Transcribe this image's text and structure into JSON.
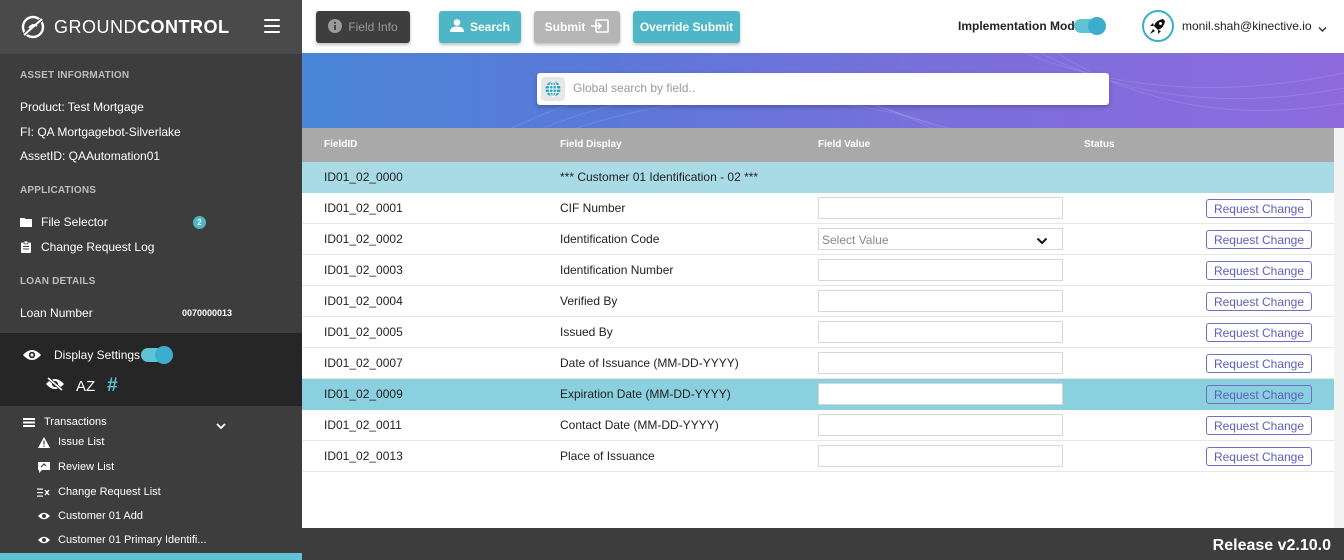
{
  "brand": {
    "name_light": "GROUND",
    "name_bold": "CONTROL"
  },
  "asset_info": {
    "title": "ASSET INFORMATION",
    "product": "Product:  Test Mortgage",
    "fi": "FI:  QA Mortgagebot-Silverlake",
    "asset_id": "AssetID:  QAAutomation01"
  },
  "applications": {
    "title": "APPLICATIONS",
    "items": [
      {
        "label": "File Selector",
        "badge": "2"
      },
      {
        "label": "Change Request Log"
      }
    ]
  },
  "loan_details": {
    "title": "LOAN DETAILS",
    "loan_label": "Loan Number",
    "loan_value": "0070000013"
  },
  "display_settings": {
    "label": "Display Settings",
    "az_label": "AZ",
    "hash_label": "#"
  },
  "transactions": {
    "label": "Transactions",
    "items": [
      {
        "label": "Issue List"
      },
      {
        "label": "Review List"
      },
      {
        "label": "Change Request List"
      },
      {
        "label": "Customer 01 Add"
      },
      {
        "label": "Customer 01 Primary Identifi..."
      }
    ]
  },
  "toolbar": {
    "field_info": "Field Info",
    "search": "Search",
    "submit": "Submit",
    "override_submit": "Override Submit",
    "implementation_mode": "Implementation Mode",
    "user_email": "monil.shah@kinective.io"
  },
  "search": {
    "placeholder": "Global search by field.."
  },
  "table": {
    "headers": {
      "field_id": "FieldID",
      "field_display": "Field Display",
      "field_value": "Field Value",
      "status": "Status"
    },
    "section": {
      "id": "ID01_02_0000",
      "display": "*** Customer 01 Identification - 02 ***"
    },
    "select_placeholder": "Select Value",
    "request_change": "Request Change",
    "rows": [
      {
        "id": "ID01_02_0001",
        "display": "CIF Number"
      },
      {
        "id": "ID01_02_0002",
        "display": "Identification Code"
      },
      {
        "id": "ID01_02_0003",
        "display": "Identification Number"
      },
      {
        "id": "ID01_02_0004",
        "display": "Verified By"
      },
      {
        "id": "ID01_02_0005",
        "display": "Issued By"
      },
      {
        "id": "ID01_02_0007",
        "display": "Date of Issuance (MM-DD-YYYY)"
      },
      {
        "id": "ID01_02_0009",
        "display": "Expiration Date (MM-DD-YYYY)"
      },
      {
        "id": "ID01_02_0011",
        "display": "Contact Date (MM-DD-YYYY)"
      },
      {
        "id": "ID01_02_0013",
        "display": "Place of Issuance"
      }
    ]
  },
  "footer": {
    "release": "Release v2.10.0"
  },
  "colors": {
    "accent": "#4fb6c7",
    "highlight_row": "#8bd0df",
    "sidebar": "#3d3d3d"
  }
}
